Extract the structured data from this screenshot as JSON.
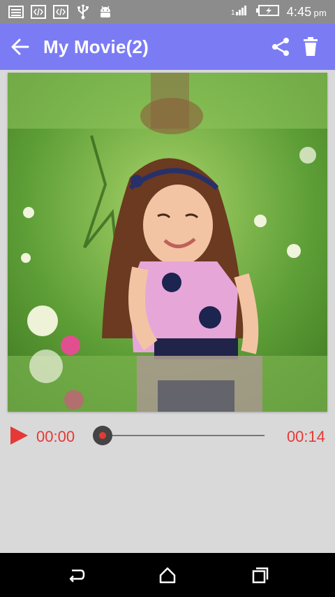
{
  "status_bar": {
    "time": "4:45",
    "ampm": "pm",
    "left_icons": [
      "image-notification-icon",
      "code-notification-icon",
      "code-notification-icon",
      "usb-icon",
      "android-debug-icon"
    ],
    "right_icons": [
      "signal-icon",
      "battery-charging-icon"
    ]
  },
  "app_bar": {
    "title": "My Movie(2)",
    "background": "#7b7cf4",
    "icons": [
      "back-arrow-icon",
      "share-icon",
      "trash-icon"
    ]
  },
  "preview": {
    "image": "Young girl with long brown hair smiling, sitting in green grass with small flowers",
    "background_color": "#6aa845"
  },
  "player": {
    "current_time": "00:00",
    "total_time": "00:14",
    "progress": 0,
    "accent": "#e53935"
  },
  "nav_bar": {
    "icons": [
      "back-icon",
      "home-icon",
      "recent-apps-icon"
    ]
  }
}
